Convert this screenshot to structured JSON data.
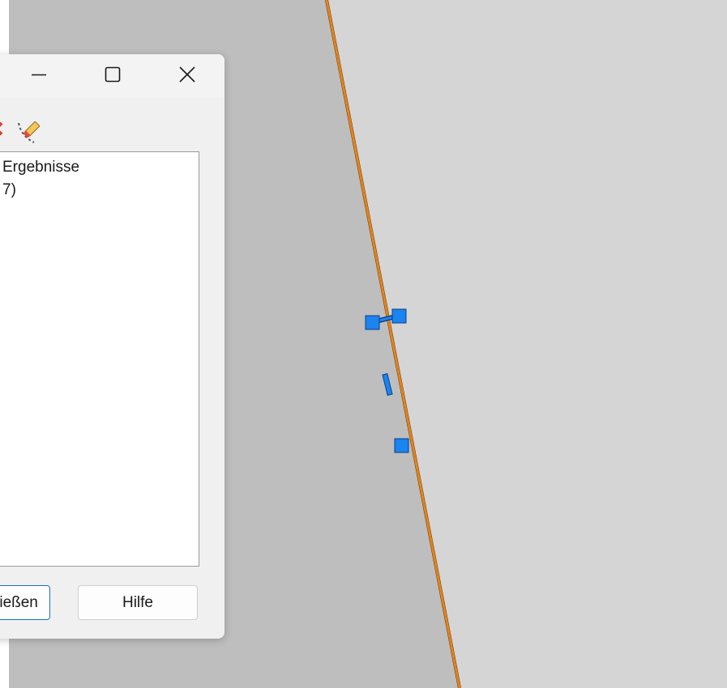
{
  "dialog": {
    "window_controls": {
      "minimize_icon": "minimize-icon",
      "maximize_icon": "maximize-icon",
      "close_icon": "close-icon"
    },
    "toolbar_icons": [
      "delete-icon",
      "erase-markers-icon"
    ],
    "tree": {
      "lines": [
        "Ergebnisse",
        "7)"
      ]
    },
    "buttons": {
      "close_label": "ließen",
      "help_label": "Hilfe"
    }
  },
  "canvas": {
    "background_dark": "#bebebe",
    "background_light": "#d5d5d5",
    "line_color": "#e8821a",
    "grip_color": "#1a84f0"
  }
}
